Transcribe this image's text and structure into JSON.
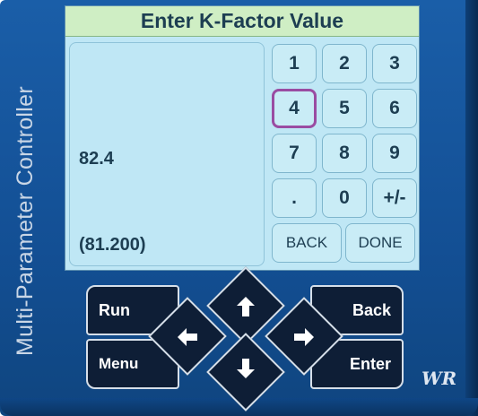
{
  "device": {
    "side_label": "Multi-Parameter Controller",
    "logo_text": "WR"
  },
  "screen": {
    "title": "Enter K-Factor Value",
    "current_value": "82.4",
    "previous_value": "(81.200)"
  },
  "keypad": {
    "keys": [
      "1",
      "2",
      "3",
      "4",
      "5",
      "6",
      "7",
      "8",
      "9",
      ".",
      "0",
      "+/-"
    ],
    "selected_key": "4",
    "back_label": "BACK",
    "done_label": "DONE"
  },
  "navpad": {
    "run_label": "Run",
    "menu_label": "Menu",
    "back_label": "Back",
    "enter_label": "Enter",
    "icons": [
      "arrow-up-icon",
      "arrow-down-icon",
      "arrow-left-icon",
      "arrow-right-icon"
    ]
  },
  "colors": {
    "screen_bg": "#bfe7f5",
    "title_bg": "#cfeec4",
    "selected_border": "#9a4ca2",
    "device_blue": "#1a5ea8",
    "button_dark": "#0e1e36"
  }
}
